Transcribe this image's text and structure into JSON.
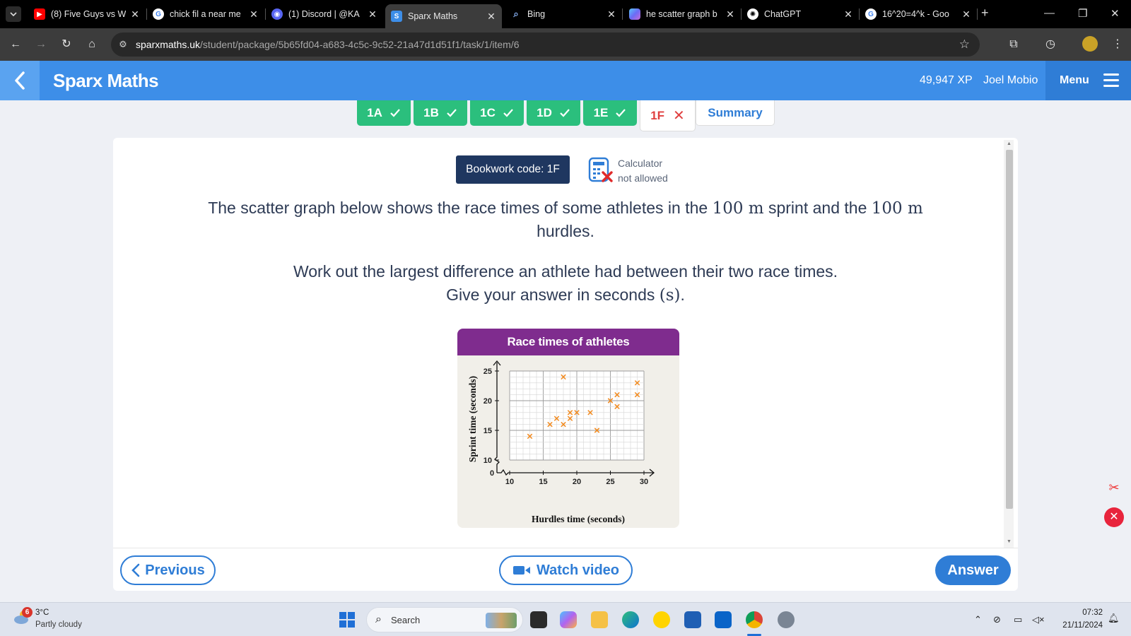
{
  "browser": {
    "tabs": [
      {
        "title": "(8) Five Guys vs W",
        "favicon": "youtube-icon",
        "color": "#ff0000"
      },
      {
        "title": "chick fil a near me",
        "favicon": "google-icon",
        "color": "#4285f4"
      },
      {
        "title": "(1) Discord | @KA",
        "favicon": "discord-icon",
        "color": "#5865f2"
      },
      {
        "title": "Sparx Maths",
        "favicon": "sparx-icon",
        "color": "#3d8ee8",
        "active": true
      },
      {
        "title": "Bing",
        "favicon": "search-icon",
        "color": "#8ab4f8"
      },
      {
        "title": "he scatter graph b",
        "favicon": "copilot-icon",
        "color": "#6b6cf6"
      },
      {
        "title": "ChatGPT",
        "favicon": "chatgpt-icon",
        "color": "#ffffff"
      },
      {
        "title": "16^20=4^k - Goo",
        "favicon": "google-icon",
        "color": "#4285f4"
      }
    ],
    "new_tab": "+",
    "url_host": "sparxmaths.uk",
    "url_path": "/student/package/5b65fd04-a683-4c5c-9c52-21a47d1d51f1/task/1/item/6"
  },
  "header": {
    "brand": "Sparx Maths",
    "xp": "49,947 XP",
    "user": "Joel Mobio",
    "menu_label": "Menu"
  },
  "task_tabs": [
    {
      "label": "1A",
      "status": "done"
    },
    {
      "label": "1B",
      "status": "done"
    },
    {
      "label": "1C",
      "status": "done"
    },
    {
      "label": "1D",
      "status": "done"
    },
    {
      "label": "1E",
      "status": "done"
    },
    {
      "label": "1F",
      "status": "wrong"
    },
    {
      "label": "Summary",
      "status": "summary"
    }
  ],
  "question": {
    "bookwork": "Bookwork code: 1F",
    "calculator_line1": "Calculator",
    "calculator_line2": "not allowed",
    "para1_a": "The scatter graph below shows the race times of some athletes in the ",
    "para1_m1": "100 m",
    "para1_b": " sprint and the ",
    "para1_m2": "100 m",
    "para1_c": "hurdles.",
    "para2": "Work out the largest difference an athlete had between their two race times.",
    "para3_a": "Give your answer in seconds ",
    "para3_m": "(s)",
    "para3_b": "."
  },
  "chart_data": {
    "type": "scatter",
    "title": "Race times of athletes",
    "xlabel": "Hurdles time (seconds)",
    "ylabel": "Sprint time (seconds)",
    "xlim": [
      10,
      30
    ],
    "ylim": [
      10,
      25
    ],
    "axis_break": true,
    "origin_label": "0",
    "xticks": [
      10,
      15,
      20,
      25,
      30
    ],
    "yticks": [
      10,
      15,
      20,
      25
    ],
    "grid": true,
    "marker_color": "#f28a1e",
    "points": [
      {
        "x": 13,
        "y": 14
      },
      {
        "x": 16,
        "y": 16
      },
      {
        "x": 17,
        "y": 17
      },
      {
        "x": 18,
        "y": 16
      },
      {
        "x": 19,
        "y": 17
      },
      {
        "x": 19,
        "y": 18
      },
      {
        "x": 20,
        "y": 18
      },
      {
        "x": 18,
        "y": 24
      },
      {
        "x": 22,
        "y": 18
      },
      {
        "x": 23,
        "y": 15
      },
      {
        "x": 25,
        "y": 20
      },
      {
        "x": 26,
        "y": 21
      },
      {
        "x": 26,
        "y": 19
      },
      {
        "x": 29,
        "y": 23
      },
      {
        "x": 29,
        "y": 21
      }
    ]
  },
  "buttons": {
    "previous": "Previous",
    "watch_video": "Watch video",
    "answer": "Answer"
  },
  "taskbar": {
    "weather_badge": "6",
    "temperature": "3°C",
    "weather": "Partly cloudy",
    "search_placeholder": "Search",
    "time": "07:32",
    "date": "21/11/2024"
  }
}
